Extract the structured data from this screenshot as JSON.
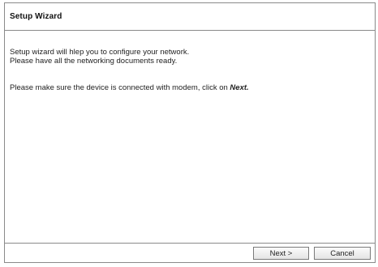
{
  "wizard": {
    "title": "Setup Wizard",
    "intro_line1": "Setup wizard will hlep you to configure your network.",
    "intro_line2": "Please have all the networking documents ready.",
    "instruction_prefix": "Please make sure the device is connected with modem, click on ",
    "instruction_next": "Next."
  },
  "buttons": {
    "next_label": "Next >",
    "cancel_label": "Cancel"
  }
}
